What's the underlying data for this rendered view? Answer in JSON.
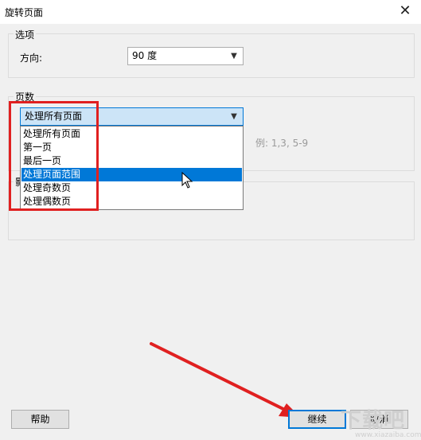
{
  "window": {
    "title": "旋转页面",
    "close_glyph": "✕"
  },
  "options_group": {
    "label": "选项",
    "direction_label": "方向:",
    "direction_value": "90 度"
  },
  "pages_group": {
    "label": "页数",
    "selected": "处理所有页面",
    "hint": "例: 1,3, 5-9",
    "options": [
      "处理所有页面",
      "第一页",
      "最后一页",
      "处理页面范围",
      "处理奇数页",
      "处理偶数页"
    ],
    "highlighted_index": 3
  },
  "third_group": {
    "label_fragment": "影"
  },
  "buttons": {
    "help": "帮助",
    "continue": "继续",
    "cancel": "取消"
  },
  "watermark": {
    "text": "下载吧",
    "sub": "www.xiazaiba.com"
  },
  "colors": {
    "accent": "#0078d7",
    "annotation": "#e02020",
    "hover": "#cce4f7"
  },
  "icons": {
    "close": "close-icon",
    "chevron": "chevron-down-icon",
    "cursor": "mouse-pointer-icon",
    "arrow": "red-annotation-arrow"
  }
}
